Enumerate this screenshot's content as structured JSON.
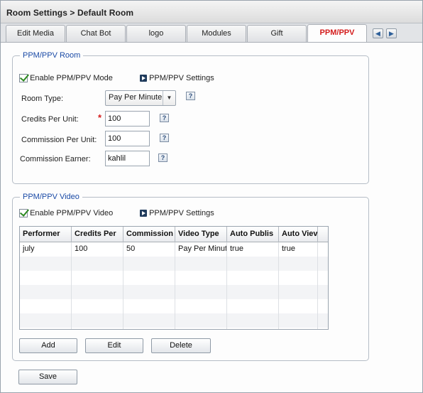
{
  "header": {
    "title": "Room Settings  > Default Room"
  },
  "tabs": [
    {
      "label": "Edit Media"
    },
    {
      "label": "Chat Bot"
    },
    {
      "label": "logo"
    },
    {
      "label": "Modules"
    },
    {
      "label": "Gift"
    },
    {
      "label": "PPM/PPV",
      "active": true
    }
  ],
  "tab_scroll": {
    "left": "◀",
    "right": "▶"
  },
  "room_section": {
    "legend": "PPM/PPV Room",
    "enable_label": "Enable PPM/PPV Mode",
    "enable_checked": true,
    "settings_link": "PPM/PPV Settings",
    "room_type_label": "Room Type:",
    "room_type_value": "Pay Per Minute",
    "credits_label": "Credits Per Unit:",
    "credits_value": "100",
    "commission_label": "Commission Per Unit:",
    "commission_value": "100",
    "earner_label": "Commission Earner:",
    "earner_value": "kahlil",
    "required_mark": "*",
    "help_glyph": "?"
  },
  "video_section": {
    "legend": "PPM/PPV Video",
    "enable_label": "Enable PPM/PPV Video",
    "enable_checked": true,
    "settings_link": "PPM/PPV Settings",
    "columns": [
      "Performer",
      "Credits Per",
      "Commission",
      "Video Type",
      "Auto Publis",
      "Auto Viev"
    ],
    "rows": [
      [
        "july",
        "100",
        "50",
        "Pay Per Minute",
        "true",
        "true"
      ]
    ],
    "add_label": "Add",
    "edit_label": "Edit",
    "delete_label": "Delete"
  },
  "save_label": "Save",
  "colors": {
    "active_tab": "#d41c1c",
    "legend": "#1a4aa6",
    "check": "#2e8a22"
  }
}
